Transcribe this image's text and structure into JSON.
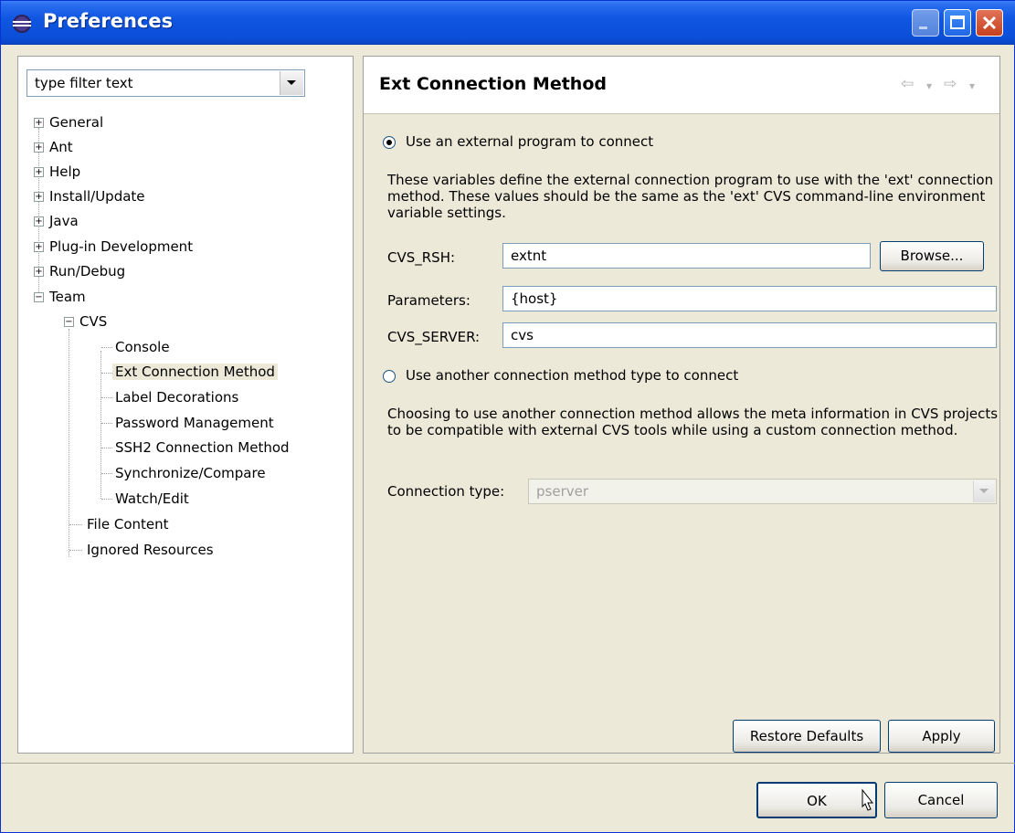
{
  "window": {
    "title": "Preferences",
    "icon": "eclipse-icon"
  },
  "filter": {
    "value": "type filter text"
  },
  "tree": [
    {
      "label": "General",
      "expander": "+"
    },
    {
      "label": "Ant",
      "expander": "+"
    },
    {
      "label": "Help",
      "expander": "+"
    },
    {
      "label": "Install/Update",
      "expander": "+"
    },
    {
      "label": "Java",
      "expander": "+"
    },
    {
      "label": "Plug-in Development",
      "expander": "+"
    },
    {
      "label": "Run/Debug",
      "expander": "+"
    },
    {
      "label": "Team",
      "expander": "−"
    },
    {
      "label": "CVS",
      "expander": "−"
    },
    {
      "label": "Console"
    },
    {
      "label": "Ext Connection Method",
      "selected": true
    },
    {
      "label": "Label Decorations"
    },
    {
      "label": "Password Management"
    },
    {
      "label": "SSH2 Connection Method"
    },
    {
      "label": "Synchronize/Compare"
    },
    {
      "label": "Watch/Edit"
    },
    {
      "label": "File Content"
    },
    {
      "label": "Ignored Resources"
    }
  ],
  "page": {
    "title": "Ext Connection Method",
    "nav": {
      "back": "⇦",
      "forward": "⇨",
      "dropdown": "▾"
    },
    "option_external": "Use an external program to connect",
    "desc_external": "These variables define the external connection program to use with the 'ext' connection method. These values should be the same as the 'ext' CVS command-line environment variable settings.",
    "cvs_rsh_label": "CVS_RSH:",
    "cvs_rsh_value": "extnt",
    "browse_label": "Browse...",
    "parameters_label": "Parameters:",
    "parameters_value": "{host}",
    "cvs_server_label": "CVS_SERVER:",
    "cvs_server_value": "cvs",
    "option_other": "Use another connection method type to connect",
    "desc_other": "Choosing to use another connection method allows the meta information in CVS projects to be compatible with external CVS tools while using a custom connection method.",
    "conn_type_label": "Connection type:",
    "conn_type_value": "pserver",
    "restore_label": "Restore Defaults",
    "apply_label": "Apply"
  },
  "footer": {
    "ok_label": "OK",
    "cancel_label": "Cancel"
  },
  "colors": {
    "titlebar": "#0b4fd8",
    "dialog_bg": "#ece9d8",
    "selection": "#ece9d8"
  }
}
